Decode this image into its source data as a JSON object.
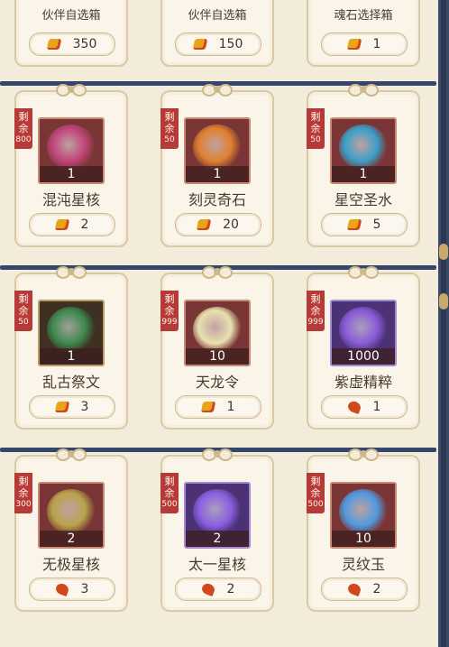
{
  "top_row": [
    {
      "name": "伙伴自选箱",
      "price": "350",
      "currency": "gold-coin"
    },
    {
      "name": "伙伴自选箱",
      "price": "150",
      "currency": "gold-coin"
    },
    {
      "name": "魂石选择箱",
      "price": "1",
      "currency": "gold-coin"
    }
  ],
  "stock_label": "剩余",
  "rows": [
    [
      {
        "name": "混沌星核",
        "stock": "800",
        "qty": "1",
        "price": "2",
        "currency": "gold-coin",
        "color": "#c0457a"
      },
      {
        "name": "刻灵奇石",
        "stock": "50",
        "qty": "1",
        "price": "20",
        "currency": "gold-coin",
        "color": "#e08030"
      },
      {
        "name": "星空圣水",
        "stock": "50",
        "qty": "1",
        "price": "5",
        "currency": "gold-coin",
        "color": "#3aa0c8"
      }
    ],
    [
      {
        "name": "乱古祭文",
        "stock": "50",
        "qty": "1",
        "price": "3",
        "currency": "gold-coin",
        "color": "#3d8a4e"
      },
      {
        "name": "天龙令",
        "stock": "999",
        "qty": "10",
        "price": "1",
        "currency": "gold-coin",
        "color": "#e9e0b0"
      },
      {
        "name": "紫虚精粹",
        "stock": "999",
        "qty": "1000",
        "price": "1",
        "currency": "red-leaf",
        "color": "#8a5bd6"
      }
    ],
    [
      {
        "name": "无极星核",
        "stock": "300",
        "qty": "2",
        "price": "3",
        "currency": "red-leaf",
        "color": "#b8a34a"
      },
      {
        "name": "太一星核",
        "stock": "500",
        "qty": "2",
        "price": "2",
        "currency": "red-leaf",
        "color": "#8a5fe0"
      },
      {
        "name": "灵纹玉",
        "stock": "500",
        "qty": "10",
        "price": "2",
        "currency": "red-leaf",
        "color": "#4f9ae0"
      }
    ]
  ]
}
